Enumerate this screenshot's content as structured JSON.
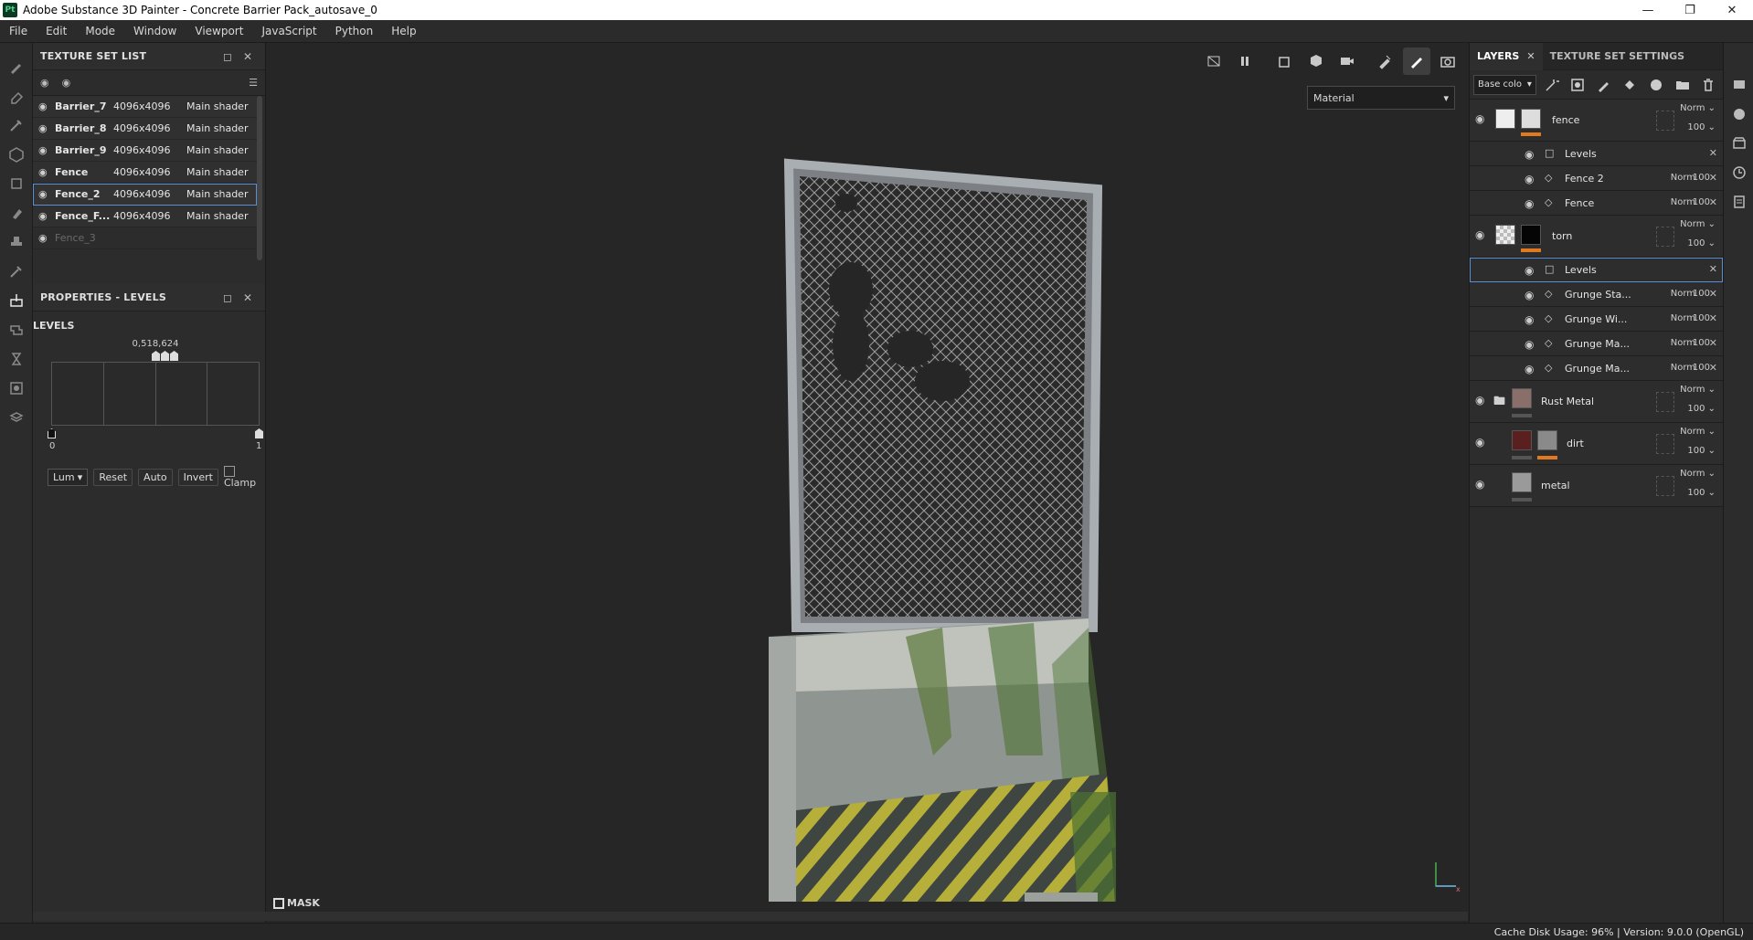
{
  "window": {
    "title": "Adobe Substance 3D Painter - Concrete Barrier Pack_autosave_0",
    "logo": "Pt"
  },
  "menu": [
    "File",
    "Edit",
    "Mode",
    "Window",
    "Viewport",
    "JavaScript",
    "Python",
    "Help"
  ],
  "texture_set_list": {
    "title": "TEXTURE SET LIST",
    "rows": [
      {
        "name": "Barrier_7",
        "res": "4096x4096",
        "shader": "Main shader"
      },
      {
        "name": "Barrier_8",
        "res": "4096x4096",
        "shader": "Main shader"
      },
      {
        "name": "Barrier_9",
        "res": "4096x4096",
        "shader": "Main shader"
      },
      {
        "name": "Fence",
        "res": "4096x4096",
        "shader": "Main shader"
      },
      {
        "name": "Fence_2",
        "res": "4096x4096",
        "shader": "Main shader"
      },
      {
        "name": "Fence_F...",
        "res": "4096x4096",
        "shader": "Main shader"
      },
      {
        "name": "Fence_3",
        "res": "",
        "shader": ""
      }
    ]
  },
  "properties": {
    "title": "PROPERTIES - LEVELS",
    "section": "LEVELS",
    "hist_values": "0,518,624",
    "min_label": "0",
    "max_label": "1",
    "channel": "Lum",
    "buttons": {
      "reset": "Reset",
      "auto": "Auto",
      "invert": "Invert"
    },
    "clamp": "Clamp"
  },
  "viewport": {
    "material_dropdown": "Material",
    "mask_label": "MASK"
  },
  "layers_panel": {
    "tabs": {
      "layers": "LAYERS",
      "settings": "TEXTURE SET SETTINGS"
    },
    "channel": "Base colo",
    "layers": [
      {
        "name": "fence",
        "blend": "Norm",
        "opacity": "100"
      },
      {
        "name": "Levels"
      },
      {
        "name": "Fence 2",
        "blend": "Norm",
        "opacity": "100"
      },
      {
        "name": "Fence",
        "blend": "Norm",
        "opacity": "100"
      },
      {
        "name": "torn",
        "blend": "Norm",
        "opacity": "100"
      },
      {
        "name": "Levels"
      },
      {
        "name": "Grunge Sta...",
        "blend": "Norm",
        "opacity": "100"
      },
      {
        "name": "Grunge Wi...",
        "blend": "Norm",
        "opacity": "100"
      },
      {
        "name": "Grunge Ma...",
        "blend": "Norm",
        "opacity": "100"
      },
      {
        "name": "Grunge Ma...",
        "blend": "Norm",
        "opacity": "100"
      },
      {
        "name": "Rust Metal",
        "blend": "Norm",
        "opacity": "100"
      },
      {
        "name": "dirt",
        "blend": "Norm",
        "opacity": "100"
      },
      {
        "name": "metal",
        "blend": "Norm",
        "opacity": "100"
      }
    ]
  },
  "status": {
    "text": "Cache Disk Usage:   96% | Version: 9.0.0 (OpenGL)"
  },
  "colors": {
    "accent": "#e07a20",
    "selection": "#5a8fd6",
    "panel": "#2b2b2b",
    "viewport": "#262626"
  }
}
